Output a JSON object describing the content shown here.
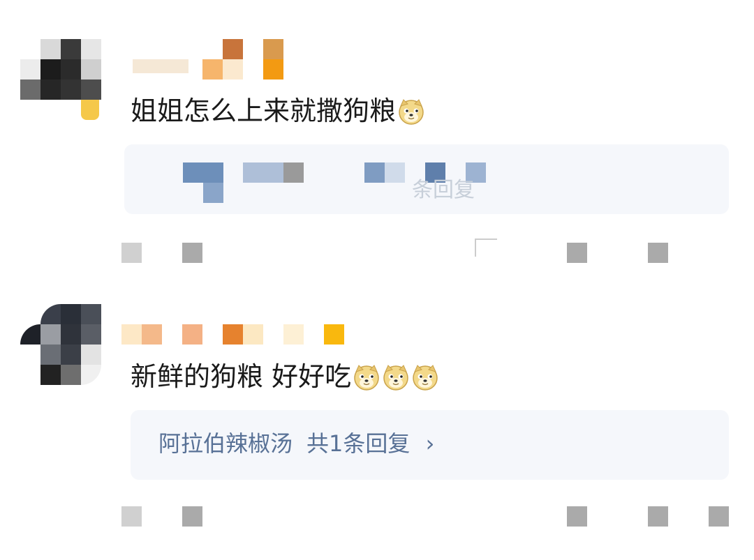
{
  "comments": [
    {
      "text": "姐姐怎么上来就撒狗粮",
      "reply_preview": "条回复",
      "emoji_icons": [
        "doge-emoji-icon"
      ]
    },
    {
      "text": "新鲜的狗粮 好好吃",
      "reply_user": "阿拉伯辣椒汤",
      "reply_count": "共1条回复",
      "reply_chevron": "›",
      "emoji_icons": [
        "doge-emoji-icon",
        "doge-emoji-icon",
        "doge-emoji-icon"
      ]
    }
  ],
  "colors": {
    "reply_link": "#587196",
    "reply_bg": "#f5f7fb",
    "text": "#1a1a1a",
    "mosaic_gray": "#aaaaaa"
  }
}
